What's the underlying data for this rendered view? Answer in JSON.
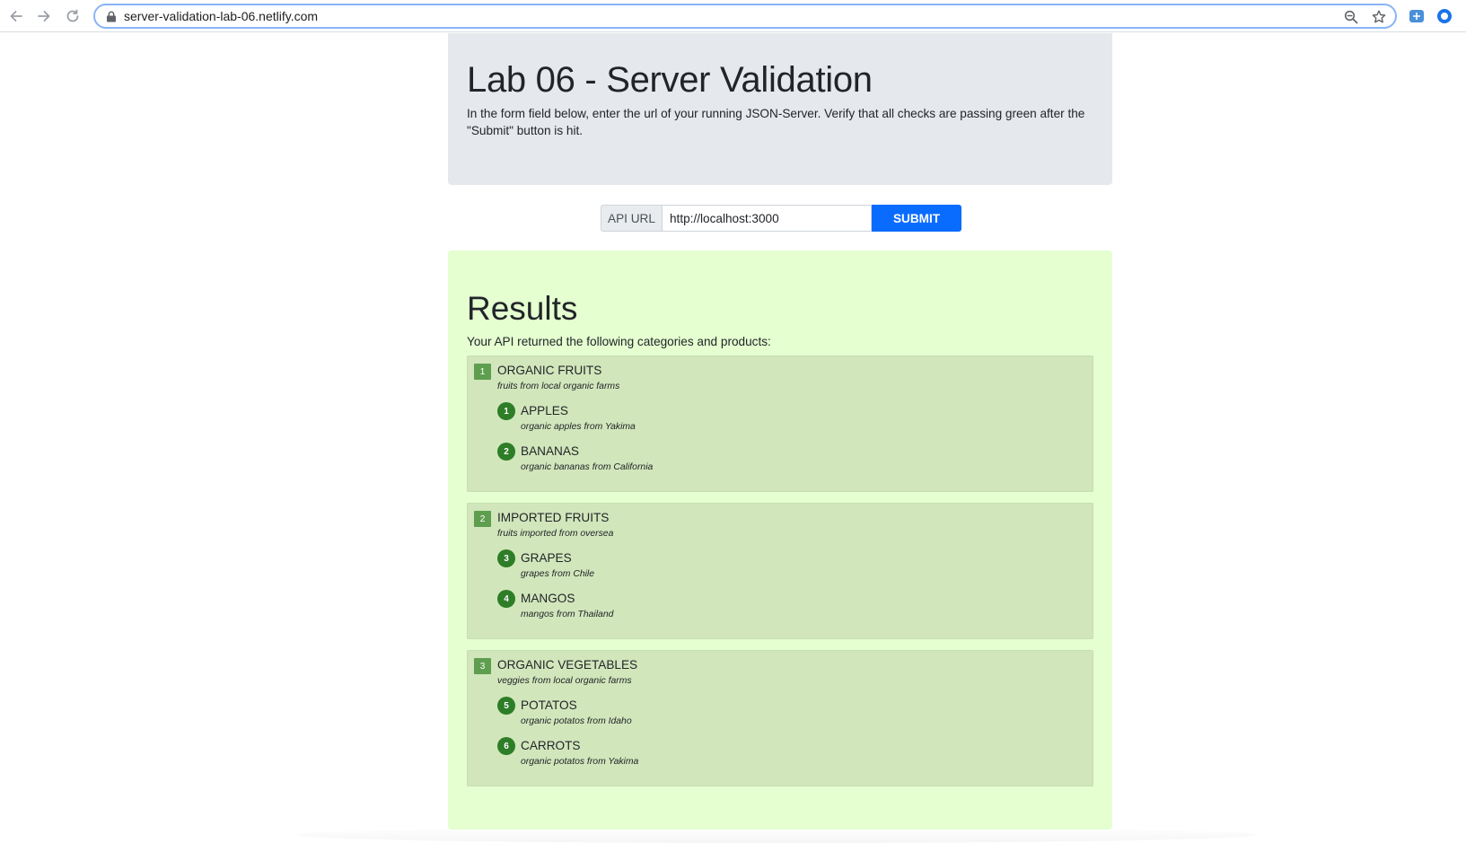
{
  "browser": {
    "url": "server-validation-lab-06.netlify.com"
  },
  "header": {
    "title": "Lab 06 - Server Validation",
    "description": "In the form field below, enter the url of your running JSON-Server. Verify that all checks are passing green after the \"Submit\" button is hit."
  },
  "form": {
    "prepend_label": "API URL",
    "url_value": "http://localhost:3000",
    "submit_label": "SUBMIT"
  },
  "results": {
    "title": "Results",
    "description": "Your API returned the following categories and products:",
    "categories": [
      {
        "id": "1",
        "name": "ORGANIC FRUITS",
        "description": "fruits from local organic farms",
        "products": [
          {
            "id": "1",
            "name": "APPLES",
            "description": "organic apples from Yakima"
          },
          {
            "id": "2",
            "name": "BANANAS",
            "description": "organic bananas from California"
          }
        ]
      },
      {
        "id": "2",
        "name": "IMPORTED FRUITS",
        "description": "fruits imported from oversea",
        "products": [
          {
            "id": "3",
            "name": "GRAPES",
            "description": "grapes from Chile"
          },
          {
            "id": "4",
            "name": "MANGOS",
            "description": "mangos from Thailand"
          }
        ]
      },
      {
        "id": "3",
        "name": "ORGANIC VEGETABLES",
        "description": "veggies from local organic farms",
        "products": [
          {
            "id": "5",
            "name": "POTATOS",
            "description": "organic potatos from Idaho"
          },
          {
            "id": "6",
            "name": "CARROTS",
            "description": "organic potatos from Yakima"
          }
        ]
      }
    ]
  },
  "colors": {
    "submit": "#0a6cff",
    "results_bg": "#e5ffd0",
    "category_bg": "#d1e6bb",
    "category_badge": "#5e9e4f",
    "product_badge": "#2e7d27"
  }
}
